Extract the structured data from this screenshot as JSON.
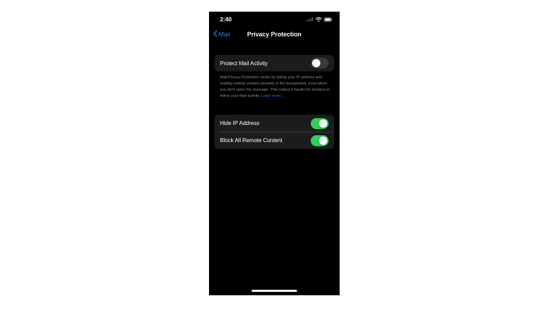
{
  "status_bar": {
    "time": "2:40",
    "icons": [
      "cellular-signal-icon",
      "wifi-icon",
      "battery-icon"
    ]
  },
  "nav": {
    "back_label": "Mail",
    "title": "Privacy Protection"
  },
  "protect_mail_activity": {
    "label": "Protect Mail Activity",
    "enabled": false
  },
  "footnote": {
    "text": "Mail Privacy Protection works by hiding your IP address and loading remote content privately in the background, even when you don't open the message. This makes it harder for senders to follow your Mail activity.",
    "link_label": "Learn more..."
  },
  "options": [
    {
      "label": "Hide IP Address",
      "enabled": true
    },
    {
      "label": "Block All Remote Content",
      "enabled": true
    }
  ],
  "colors": {
    "background": "#000000",
    "cell_background": "#1c1c1e",
    "accent_blue": "#0a84ff",
    "toggle_on": "#30d158",
    "toggle_off": "#39393d",
    "secondary_text": "#8e8e93"
  }
}
